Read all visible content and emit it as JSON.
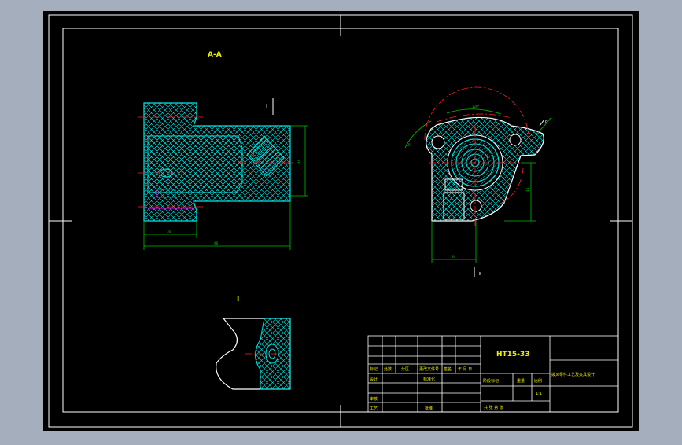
{
  "colors": {
    "viewport_bg": "#a5aebd",
    "paper": "#000000",
    "frame": "#ffffff",
    "hatch": "#00e5e5",
    "dimension": "#00c000",
    "centerline": "#ff2020",
    "hidden": "#ff00ff",
    "label": "#f0f000"
  },
  "views": {
    "section_label": "A-A",
    "section_marker": "I",
    "detail_label": "I",
    "front_marker_right": "B",
    "front_marker_bottom": "B"
  },
  "title_block": {
    "drawing_number": "HT15-33",
    "drawing_title": "拨叉零件工艺及夹具设计",
    "scale_value": "1:1",
    "rev_row": [
      "标记",
      "处数",
      "分区",
      "更改文件号",
      "签名",
      "年.月.日"
    ],
    "design_row": [
      "设计",
      "",
      "标准化"
    ],
    "review_label": "审核",
    "process_label": "工艺",
    "approve_label": "批准",
    "stage_headers": [
      "阶段标记",
      "重量",
      "比例"
    ],
    "sheet_row": "共  张  第  张"
  }
}
